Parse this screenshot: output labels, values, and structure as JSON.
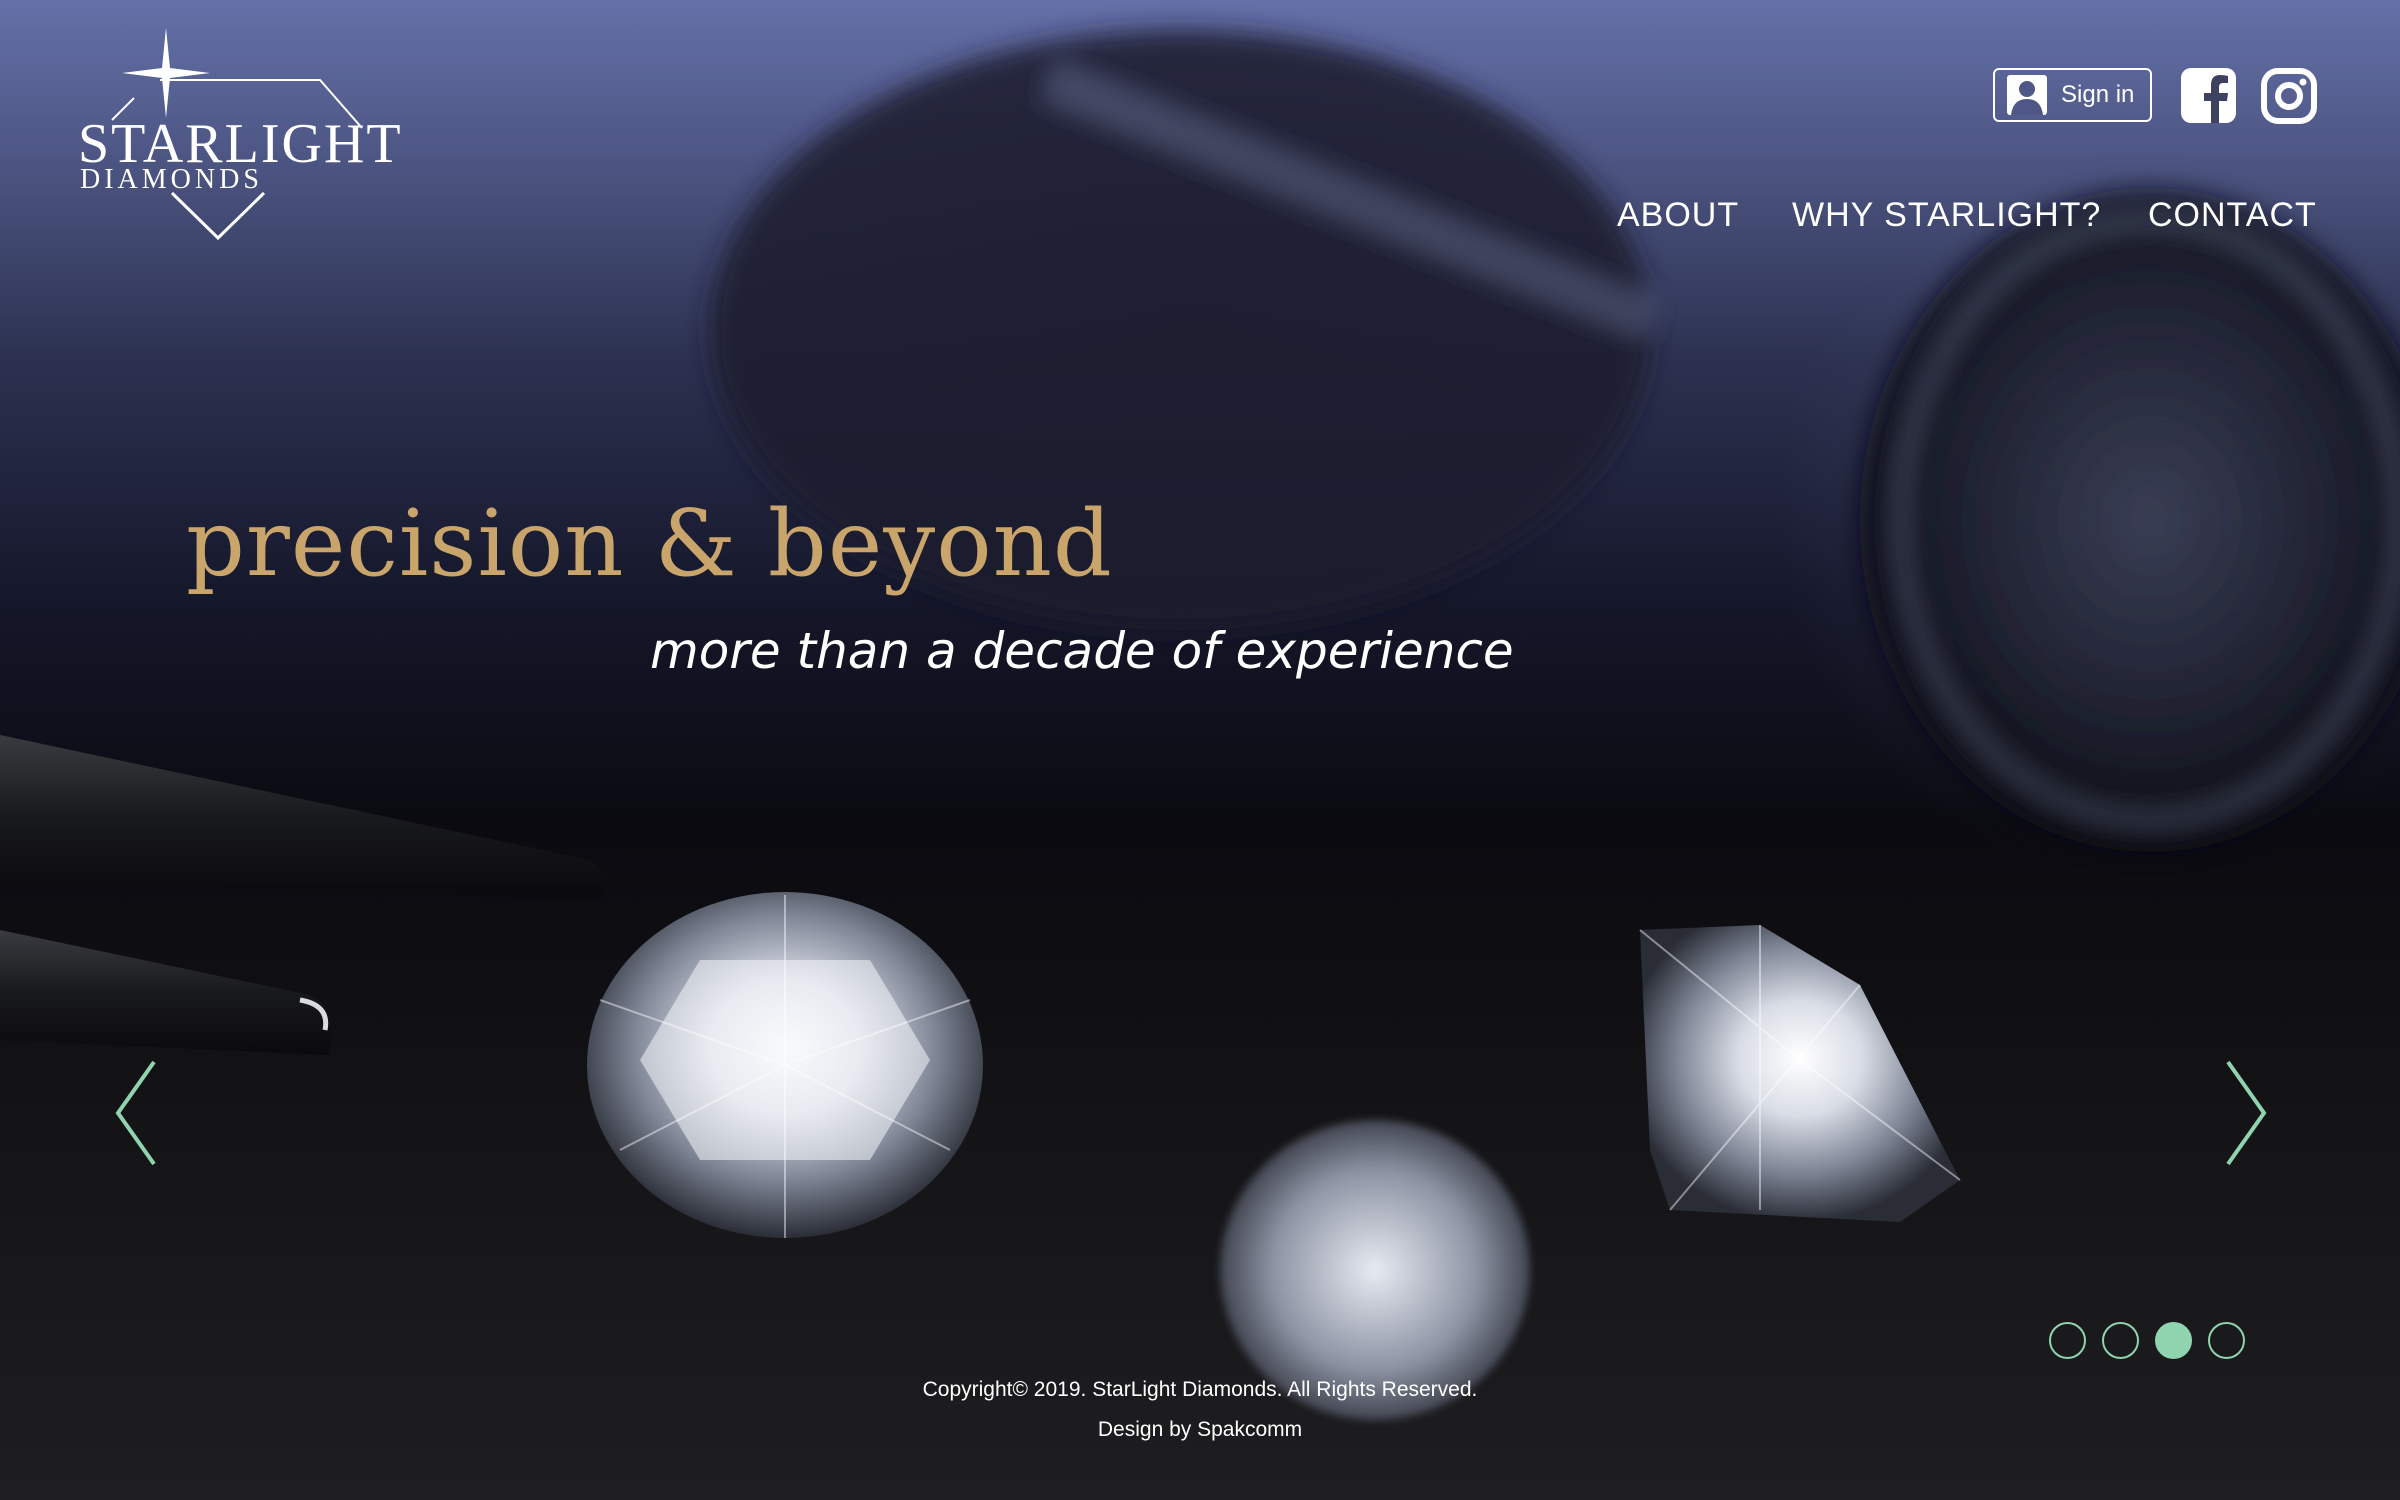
{
  "brand": {
    "name": "STARLIGHT",
    "sub": "DIAMONDS"
  },
  "header": {
    "signin_label": "Sign in",
    "icons": [
      "user-icon",
      "facebook-icon",
      "instagram-icon"
    ]
  },
  "nav": {
    "items": [
      "ABOUT",
      "WHY STARLIGHT?",
      "CONTACT"
    ]
  },
  "hero": {
    "headline": "precision & beyond",
    "tagline": "more than a decade of experience"
  },
  "carousel": {
    "slides": 4,
    "active_index": 2
  },
  "footer": {
    "copyright": "Copyright© 2019. StarLight Diamonds. All Rights Reserved.",
    "credit": "Design by Spakcomm"
  },
  "colors": {
    "gold": "#c9a56b",
    "mint": "#8fd4ae",
    "sky_top": "#6470a8"
  }
}
